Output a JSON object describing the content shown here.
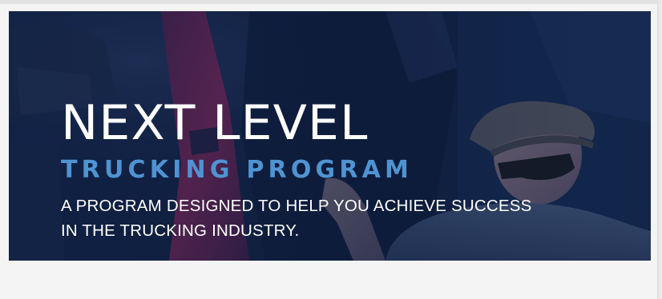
{
  "hero": {
    "headline": "NEXT LEVEL",
    "subheadline": "TRUCKING PROGRAM",
    "description": "A PROGRAM DESIGNED TO HELP YOU ACHIEVE SUCCESS IN THE TRUCKING INDUSTRY."
  },
  "colors": {
    "overlay": "#0f2144",
    "headline": "#ffffff",
    "subheadline": "#4f93d2",
    "accent_magenta": "#8a1f52"
  }
}
